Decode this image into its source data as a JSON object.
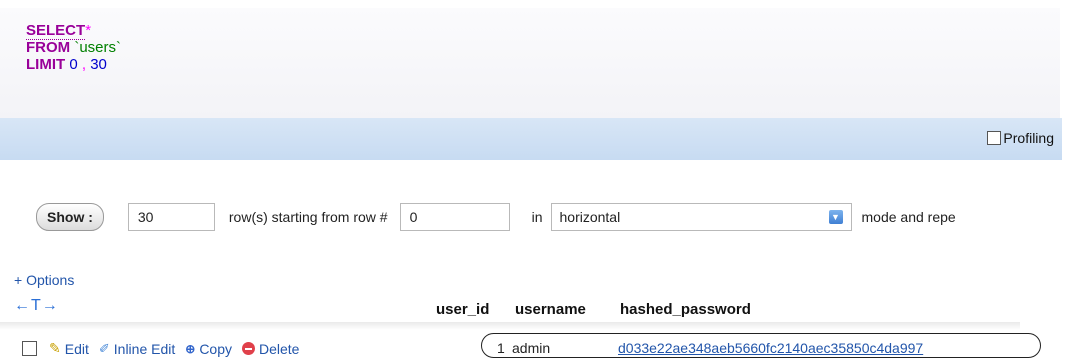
{
  "query": {
    "select_kw": "SELECT",
    "star": "*",
    "from_kw": "FROM",
    "table": "`users`",
    "limit_kw": "LIMIT",
    "limit_offset": "0",
    "limit_sep": ",",
    "limit_count": "30"
  },
  "profiling": {
    "label": "Profiling"
  },
  "nav": {
    "show_label": "Show :",
    "rows_value": "30",
    "rows_text": "row(s) starting from row #",
    "start_value": "0",
    "in_text": "in",
    "mode_value": "horizontal",
    "mode_text": "mode and repe"
  },
  "options_label": "+ Options",
  "sort_arrows": "←T→",
  "columns": [
    "user_id",
    "username",
    "hashed_password"
  ],
  "row_actions": {
    "edit": "Edit",
    "inline_edit": "Inline Edit",
    "copy": "Copy",
    "delete": "Delete"
  },
  "rows": [
    {
      "user_id": "1",
      "username": "admin",
      "hashed_password": "d033e22ae348aeb5660fc2140aec35850c4da997"
    }
  ],
  "colors": {
    "keyword": "#990099",
    "string": "#008000",
    "number": "#0000cc",
    "link": "#2255aa",
    "bar": "#c7dbf2"
  }
}
